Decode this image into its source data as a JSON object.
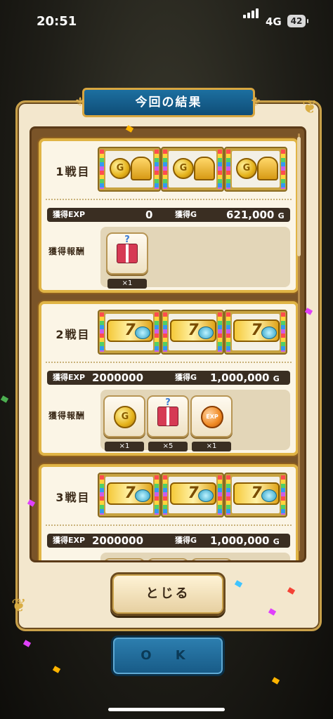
{
  "status_bar": {
    "time": "20:51",
    "network": "4G",
    "battery": "42"
  },
  "dialog": {
    "title": "今回の結果",
    "close_label": "とじる"
  },
  "ok_label": "O K",
  "labels": {
    "exp": "獲得EXP",
    "gold": "獲得G",
    "reward": "獲得報酬",
    "gold_unit": "G"
  },
  "battles": [
    {
      "label": "1戦目",
      "exp": "0",
      "gold": "621,000",
      "slots": [
        "gold-bell-slot",
        "gold-bell-slot",
        "gold-bell-slot"
      ],
      "rewards": [
        {
          "icon": "mystery-gift-icon",
          "count": "×1"
        }
      ]
    },
    {
      "label": "2戦目",
      "exp": "2000000",
      "gold": "1,000,000",
      "slots": [
        "seven-gem-slot",
        "seven-gem-slot",
        "seven-gem-slot"
      ],
      "rewards": [
        {
          "icon": "gold-coin-icon",
          "count": "×1"
        },
        {
          "icon": "mystery-gift-icon",
          "count": "×5"
        },
        {
          "icon": "exp-orb-icon",
          "count": "×1"
        }
      ]
    },
    {
      "label": "3戦目",
      "exp": "2000000",
      "gold": "1,000,000",
      "slots": [
        "seven-gem-slot",
        "seven-gem-slot",
        "seven-gem-slot"
      ],
      "rewards": [
        {
          "icon": "gold-coin-icon",
          "count": ""
        },
        {
          "icon": "mystery-gift-icon",
          "count": ""
        },
        {
          "icon": "exp-orb-icon",
          "count": ""
        }
      ]
    }
  ],
  "colors": {
    "title_plate": "#1c6fa0",
    "card_border": "#e0b445",
    "ok_button": "#2d7fb0"
  }
}
